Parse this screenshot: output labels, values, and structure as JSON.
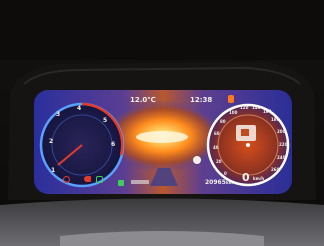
{
  "status_bar": {
    "temperature": "12.0℃",
    "time": "12:38"
  },
  "tachometer": {
    "ticks": [
      "1",
      "2",
      "3",
      "4",
      "5",
      "6"
    ]
  },
  "speedometer": {
    "ticks": [
      "0",
      "20",
      "40",
      "60",
      "80",
      "100",
      "120",
      "140",
      "160",
      "180",
      "200",
      "220",
      "240",
      "260"
    ],
    "speed": "0",
    "unit": "km/h"
  },
  "odometer": {
    "value": "20965",
    "unit": "km"
  },
  "colors": {
    "glow_core": "#fff2c8",
    "glow_orange": "#ff8a1c",
    "screen_blue": "#3c3fb4",
    "left_gauge_ring": "#5aa0ff",
    "right_gauge_ring": "#ffffff",
    "warning_red": "#e23b2b",
    "indicator_green": "#3ccf5a"
  },
  "icons": [
    "warning-light-icon",
    "parking-brake-icon",
    "headlight-icon",
    "fuel-icon",
    "seatbelt-icon",
    "info-icon"
  ]
}
